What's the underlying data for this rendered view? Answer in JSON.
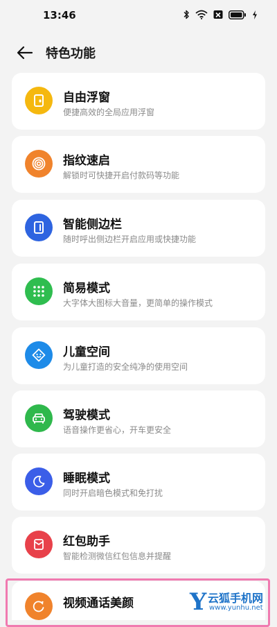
{
  "status_bar": {
    "time": "13:46",
    "icons": [
      "bluetooth-icon",
      "wifi-icon",
      "box-x-icon",
      "battery-icon",
      "charging-icon"
    ]
  },
  "header": {
    "back_icon": "arrow-left-icon",
    "title": "特色功能"
  },
  "features": [
    {
      "title": "自由浮窗",
      "subtitle": "便捷高效的全局应用浮窗",
      "icon": "floating-window-icon",
      "color": "#f5b80f"
    },
    {
      "title": "指纹速启",
      "subtitle": "解锁时可快捷开启付款码等功能",
      "icon": "fingerprint-icon",
      "color": "#f0832c"
    },
    {
      "title": "智能侧边栏",
      "subtitle": "随时呼出侧边栏开启应用或快捷功能",
      "icon": "sidebar-icon",
      "color": "#2e64e0"
    },
    {
      "title": "简易模式",
      "subtitle": "大字体大图标大音量，更简单的操作模式",
      "icon": "grid-dots-icon",
      "color": "#2fbd4f"
    },
    {
      "title": "儿童空间",
      "subtitle": "为儿童打造的安全纯净的使用空间",
      "icon": "child-face-icon",
      "color": "#1e8be8"
    },
    {
      "title": "驾驶模式",
      "subtitle": "语音操作更省心，开车更安全",
      "icon": "car-icon",
      "color": "#2fb84c"
    },
    {
      "title": "睡眠模式",
      "subtitle": "同时开启暗色模式和免打扰",
      "icon": "moon-icon",
      "color": "#3b5ee8"
    },
    {
      "title": "红包助手",
      "subtitle": "智能检测微信红包信息并提醒",
      "icon": "red-envelope-icon",
      "color": "#e8414a"
    },
    {
      "title": "视频通话美颜",
      "subtitle": "",
      "icon": "beauty-icon",
      "color": "#f0832c"
    }
  ],
  "watermark": {
    "logo": "Y",
    "name": "云狐手机网",
    "url": "www.yunhu.net"
  }
}
